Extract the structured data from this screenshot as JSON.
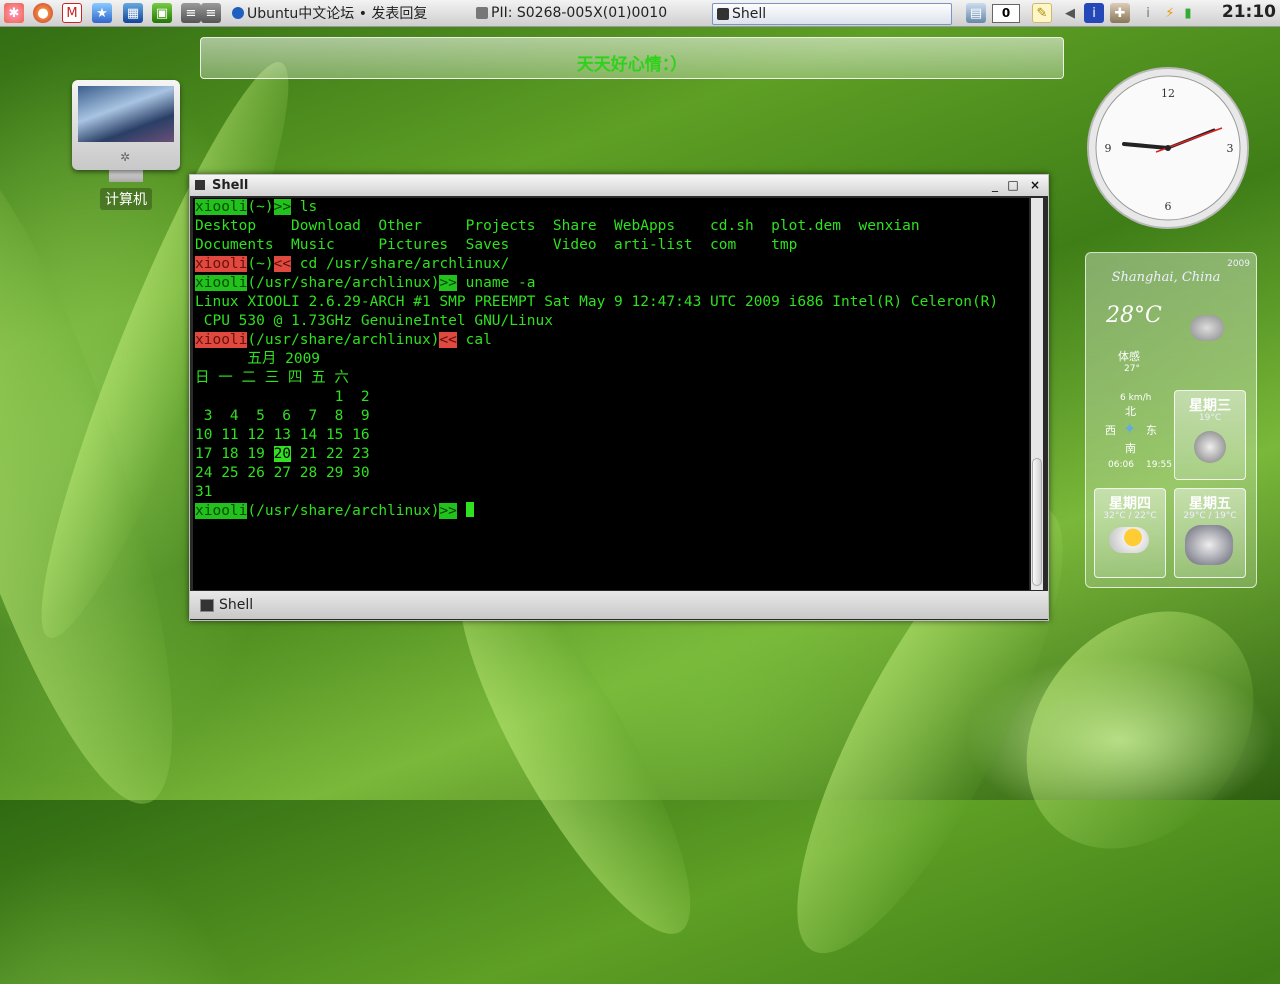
{
  "panel": {
    "launchers": [
      "kde-menu-icon",
      "firefox-icon",
      "gmail-icon",
      "bookmarks-icon",
      "system-monitor-icon",
      "image-viewer-icon",
      "drive-icon",
      "drive2-icon"
    ],
    "tasks": [
      {
        "label": "Ubuntu中文论坛 • 发表回复",
        "icon_color": "#1f5fbf"
      },
      {
        "label": "PII: S0268-005X(01)0010",
        "icon_color": "#666666"
      },
      {
        "label": "Shell",
        "icon_color": "#333333",
        "active": true
      }
    ],
    "tray_counter": "0",
    "time": "21:10"
  },
  "message_bar": {
    "text": "天天好心情：）"
  },
  "desktop_icons": [
    {
      "label": "计算机"
    }
  ],
  "weather": {
    "date": "2009",
    "city": "Shanghai, China",
    "current_temp": "28°C",
    "feels_label": "体感",
    "feels_value": "27°",
    "wind_speed": "6 km/h",
    "compass": {
      "n": "北",
      "s": "南",
      "w": "西",
      "e": "东"
    },
    "sunrise": "06:06",
    "sunset": "19:55",
    "forecast": [
      {
        "day": "星期三",
        "range": "19°C",
        "icon": "cloudy-night-icon"
      },
      {
        "day": "星期四",
        "range": "32°C / 22°C",
        "icon": "partly-sunny-icon"
      },
      {
        "day": "星期五",
        "range": "29°C / 19°C",
        "icon": "thunderstorm-icon"
      }
    ]
  },
  "window": {
    "title": "Shell",
    "tab_label": "Shell",
    "controls": [
      "_",
      "□",
      "×"
    ]
  },
  "terminal": {
    "user": "xiooli",
    "lines": [
      {
        "type": "prompt",
        "dir": "(~)",
        "arrow": ">>",
        "status": "ok",
        "cmd": "ls"
      },
      {
        "type": "out",
        "text": "Desktop    Download  Other     Projects  Share  WebApps    cd.sh  plot.dem  wenxian"
      },
      {
        "type": "out",
        "text": "Documents  Music     Pictures  Saves     Video  arti-list  com    tmp"
      },
      {
        "type": "prompt",
        "dir": "(~)",
        "arrow": "<<",
        "status": "err",
        "cmd": "cd /usr/share/archlinux/"
      },
      {
        "type": "prompt",
        "dir": "(/usr/share/archlinux)",
        "arrow": ">>",
        "status": "ok",
        "cmd": "uname -a"
      },
      {
        "type": "out",
        "text": "Linux XIOOLI 2.6.29-ARCH #1 SMP PREEMPT Sat May 9 12:47:43 UTC 2009 i686 Intel(R) Celeron(R)"
      },
      {
        "type": "out",
        "text": " CPU 530 @ 1.73GHz GenuineIntel GNU/Linux"
      },
      {
        "type": "prompt",
        "dir": "(/usr/share/archlinux)",
        "arrow": "<<",
        "status": "err",
        "cmd": "cal"
      },
      {
        "type": "out",
        "text": "      五月 2009"
      },
      {
        "type": "out",
        "text": "日 一 二 三 四 五 六"
      },
      {
        "type": "out",
        "text": "                1  2"
      },
      {
        "type": "out",
        "text": " 3  4  5  6  7  8  9"
      },
      {
        "type": "out",
        "text": "10 11 12 13 14 15 16"
      },
      {
        "type": "cal_today",
        "before": "17 18 19 ",
        "today": "20",
        "after": " 21 22 23"
      },
      {
        "type": "out",
        "text": "24 25 26 27 28 29 30"
      },
      {
        "type": "out",
        "text": "31"
      },
      {
        "type": "prompt",
        "dir": "(/usr/share/archlinux)",
        "arrow": ">>",
        "status": "ok",
        "cmd": "",
        "cursor": true
      }
    ]
  },
  "colors": {
    "term_green": "#2fe11f",
    "ok_bg": "#22c21c",
    "err_bg": "#e0493f"
  }
}
